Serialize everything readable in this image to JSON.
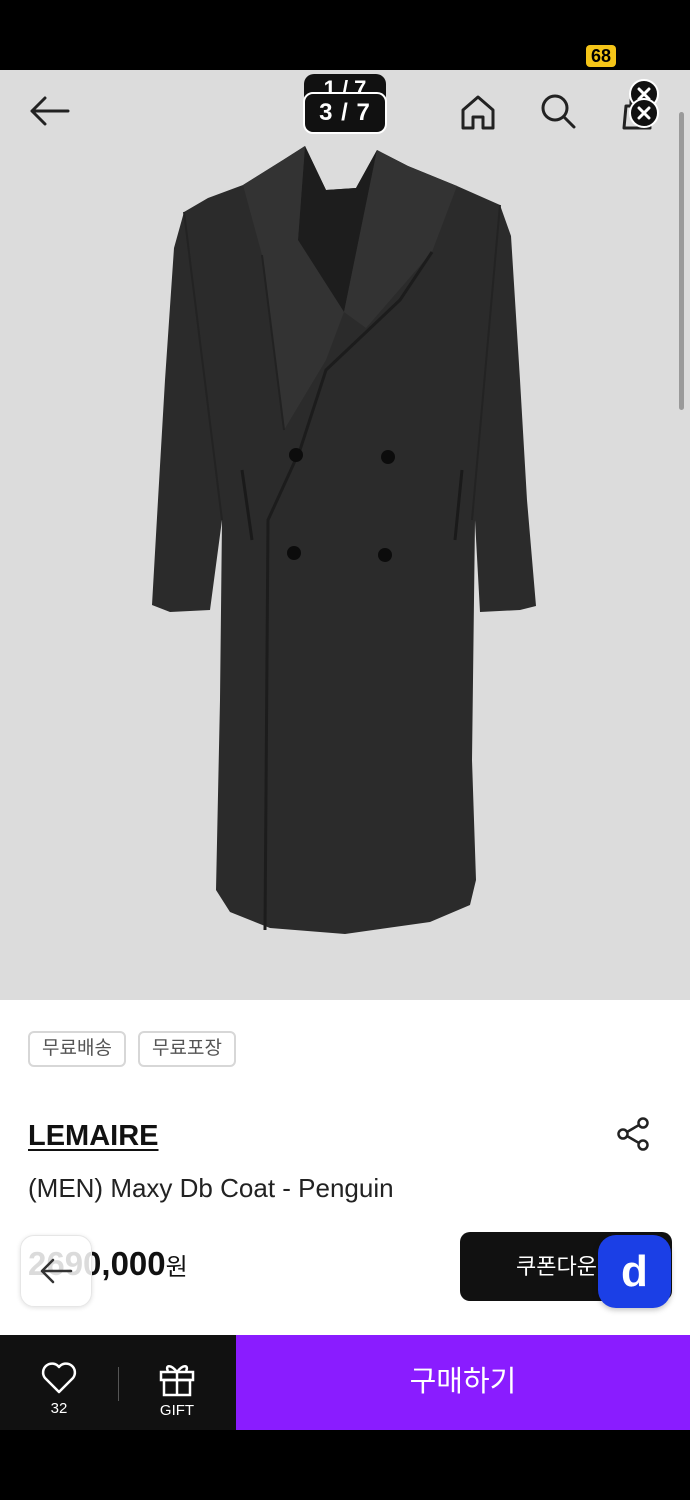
{
  "status": {
    "battery": "68",
    "battery_color": "#f5c518"
  },
  "gallery": {
    "counter": "3 / 7",
    "counter_ghost": "1 / 7",
    "progress": 0.55,
    "background": "#dcdcdc",
    "icons": [
      "back-arrow-icon",
      "home-icon",
      "search-icon",
      "cart-icon",
      "close-icon"
    ]
  },
  "product": {
    "tags": [
      "무료배송",
      "무료포장"
    ],
    "brand": "LEMAIRE",
    "title": "(MEN) Maxy Db Coat - Penguin",
    "price": "2,690,000",
    "price_visible": "2690,000",
    "currency": "원"
  },
  "actions": {
    "coupon_label": "쿠폰다운",
    "badge_letter": "d",
    "badge_color": "#1b3fe6",
    "like_count": "32",
    "gift_label": "GIFT",
    "buy_label": "구매하기",
    "buy_color": "#8a1cff"
  }
}
